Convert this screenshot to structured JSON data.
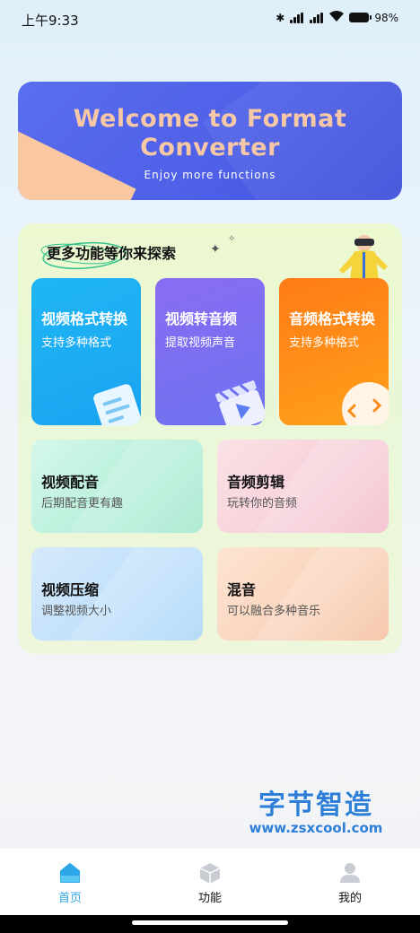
{
  "status_bar": {
    "time": "上午9:33",
    "battery": "98%"
  },
  "banner": {
    "title_line1": "Welcome to Format",
    "title_line2": "Converter",
    "subtitle": "Enjoy more functions"
  },
  "panel": {
    "title": "更多功能等你来探索"
  },
  "feature_cards": [
    {
      "title": "视频格式转换",
      "subtitle": "支持多种格式",
      "icon": "file-icon",
      "color": "#1fb6f5"
    },
    {
      "title": "视频转音频",
      "subtitle": "提取视频声音",
      "icon": "clapperboard-icon",
      "color": "#7b6ef2"
    },
    {
      "title": "音频格式转换",
      "subtitle": "支持多种格式",
      "icon": "audio-face-icon",
      "color": "#ff8a18"
    }
  ],
  "tool_cards": [
    {
      "title": "视频配音",
      "subtitle": "后期配音更有趣",
      "color": "#b6efd9"
    },
    {
      "title": "音频剪辑",
      "subtitle": "玩转你的音频",
      "color": "#f7cfd9"
    },
    {
      "title": "视频压缩",
      "subtitle": "调整视频大小",
      "color": "#bfe0fb"
    },
    {
      "title": "混音",
      "subtitle": "可以融合多种音乐",
      "color": "#f9d3bb"
    }
  ],
  "watermark": {
    "line1": "字节智造",
    "line2": "www.zsxcool.com"
  },
  "tab_bar": {
    "tabs": [
      {
        "label": "首页",
        "icon": "home-icon",
        "active": true
      },
      {
        "label": "功能",
        "icon": "cube-icon",
        "active": false
      },
      {
        "label": "我的",
        "icon": "user-icon",
        "active": false
      }
    ],
    "active_color": "#2ea7e8"
  }
}
